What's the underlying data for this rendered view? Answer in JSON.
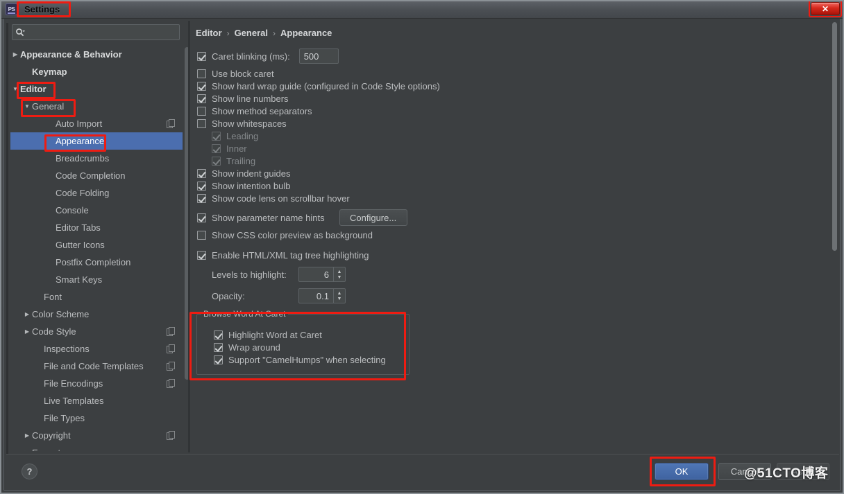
{
  "window": {
    "title": "Settings",
    "app_icon": "ps-icon",
    "close_label": "✕",
    "watermark": "@51CTO博客"
  },
  "search": {
    "value": "",
    "placeholder": "",
    "icon": "search-icon"
  },
  "sidebar": {
    "items": [
      {
        "label": "Appearance & Behavior",
        "twisty": "▶",
        "indent": 0,
        "bold": true,
        "selected": false,
        "copy": false
      },
      {
        "label": "Keymap",
        "twisty": "",
        "indent": 1,
        "bold": true,
        "selected": false,
        "copy": false
      },
      {
        "label": "Editor",
        "twisty": "▼",
        "indent": 0,
        "bold": true,
        "selected": false,
        "copy": false
      },
      {
        "label": "General",
        "twisty": "▼",
        "indent": 1,
        "bold": false,
        "selected": false,
        "copy": false
      },
      {
        "label": "Auto Import",
        "twisty": "",
        "indent": 3,
        "bold": false,
        "selected": false,
        "copy": true
      },
      {
        "label": "Appearance",
        "twisty": "",
        "indent": 3,
        "bold": false,
        "selected": true,
        "copy": false
      },
      {
        "label": "Breadcrumbs",
        "twisty": "",
        "indent": 3,
        "bold": false,
        "selected": false,
        "copy": false
      },
      {
        "label": "Code Completion",
        "twisty": "",
        "indent": 3,
        "bold": false,
        "selected": false,
        "copy": false
      },
      {
        "label": "Code Folding",
        "twisty": "",
        "indent": 3,
        "bold": false,
        "selected": false,
        "copy": false
      },
      {
        "label": "Console",
        "twisty": "",
        "indent": 3,
        "bold": false,
        "selected": false,
        "copy": false
      },
      {
        "label": "Editor Tabs",
        "twisty": "",
        "indent": 3,
        "bold": false,
        "selected": false,
        "copy": false
      },
      {
        "label": "Gutter Icons",
        "twisty": "",
        "indent": 3,
        "bold": false,
        "selected": false,
        "copy": false
      },
      {
        "label": "Postfix Completion",
        "twisty": "",
        "indent": 3,
        "bold": false,
        "selected": false,
        "copy": false
      },
      {
        "label": "Smart Keys",
        "twisty": "",
        "indent": 3,
        "bold": false,
        "selected": false,
        "copy": false
      },
      {
        "label": "Font",
        "twisty": "",
        "indent": 2,
        "bold": false,
        "selected": false,
        "copy": false
      },
      {
        "label": "Color Scheme",
        "twisty": "▶",
        "indent": 1,
        "bold": false,
        "selected": false,
        "copy": false
      },
      {
        "label": "Code Style",
        "twisty": "▶",
        "indent": 1,
        "bold": false,
        "selected": false,
        "copy": true
      },
      {
        "label": "Inspections",
        "twisty": "",
        "indent": 2,
        "bold": false,
        "selected": false,
        "copy": true
      },
      {
        "label": "File and Code Templates",
        "twisty": "",
        "indent": 2,
        "bold": false,
        "selected": false,
        "copy": true
      },
      {
        "label": "File Encodings",
        "twisty": "",
        "indent": 2,
        "bold": false,
        "selected": false,
        "copy": true
      },
      {
        "label": "Live Templates",
        "twisty": "",
        "indent": 2,
        "bold": false,
        "selected": false,
        "copy": false
      },
      {
        "label": "File Types",
        "twisty": "",
        "indent": 2,
        "bold": false,
        "selected": false,
        "copy": false
      },
      {
        "label": "Copyright",
        "twisty": "▶",
        "indent": 1,
        "bold": false,
        "selected": false,
        "copy": true
      },
      {
        "label": "Emmet",
        "twisty": "▶",
        "indent": 1,
        "bold": false,
        "selected": false,
        "copy": false
      }
    ]
  },
  "breadcrumb": {
    "part1": "Editor",
    "sep1": "›",
    "part2": "General",
    "sep2": "›",
    "part3": "Appearance"
  },
  "options": {
    "caret_blinking": {
      "label": "Caret blinking (ms):",
      "checked": true,
      "value": "500"
    },
    "use_block_caret": {
      "label": "Use block caret",
      "checked": false
    },
    "show_hard_wrap": {
      "label": "Show hard wrap guide (configured in Code Style options)",
      "checked": true
    },
    "show_line_numbers": {
      "label": "Show line numbers",
      "checked": true
    },
    "show_method_separators": {
      "label": "Show method separators",
      "checked": false
    },
    "show_whitespaces": {
      "label": "Show whitespaces",
      "checked": false
    },
    "leading": {
      "label": "Leading",
      "checked": true,
      "disabled": true
    },
    "inner": {
      "label": "Inner",
      "checked": true,
      "disabled": true
    },
    "trailing": {
      "label": "Trailing",
      "checked": true,
      "disabled": true
    },
    "show_indent_guides": {
      "label": "Show indent guides",
      "checked": true
    },
    "show_intention_bulb": {
      "label": "Show intention bulb",
      "checked": true
    },
    "show_code_lens": {
      "label": "Show code lens on scrollbar hover",
      "checked": true
    },
    "show_parameter_hints": {
      "label": "Show parameter name hints",
      "checked": true,
      "button": "Configure..."
    },
    "show_css_preview": {
      "label": "Show CSS color preview as background",
      "checked": false
    },
    "enable_tag_tree": {
      "label": "Enable HTML/XML tag tree highlighting",
      "checked": true
    },
    "levels_to_highlight": {
      "label": "Levels to highlight:",
      "value": "6"
    },
    "opacity": {
      "label": "Opacity:",
      "value": "0.1"
    }
  },
  "browse_word_group": {
    "title": "Browse Word At Caret",
    "items": [
      {
        "label": "Highlight Word at Caret",
        "checked": true
      },
      {
        "label": "Wrap around",
        "checked": true
      },
      {
        "label": "Support \"CamelHumps\" when selecting",
        "checked": true
      }
    ]
  },
  "footer": {
    "help": "?",
    "ok": "OK",
    "cancel": "Cancel",
    "apply": "Apply"
  }
}
